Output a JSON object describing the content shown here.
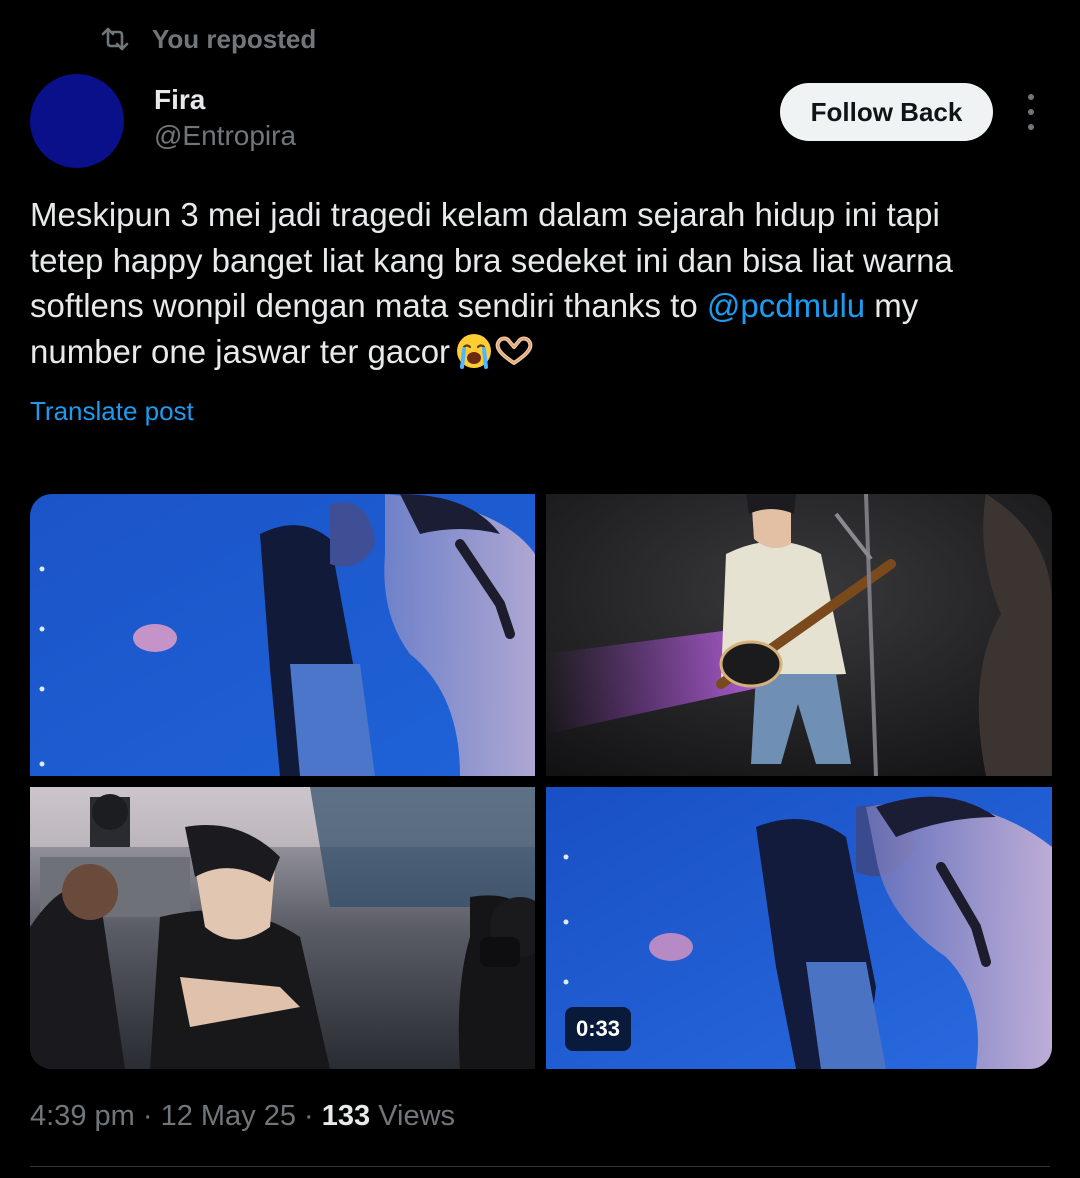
{
  "repost": {
    "label": "You reposted",
    "icon": "repost-icon"
  },
  "author": {
    "name": "Fira",
    "handle": "@Entropira",
    "avatar_color": "#0a0f8a"
  },
  "actions": {
    "follow_label": "Follow Back",
    "more_icon": "more-vertical-icon"
  },
  "tweet": {
    "line1": "Meskipun 3 mei jadi tragedi kelam dalam sejarah hidup ini tapi",
    "line2": "tetep happy banget liat kang bra sedeket ini dan bisa liat warna",
    "line3_before": "softlens wonpil dengan mata sendiri thanks to ",
    "mention": "@pcdmulu",
    "line3_after": " my",
    "line4": "number one jaswar ter gacor",
    "emojis": [
      "loudly-crying-face-emoji",
      "heart-hands-emoji"
    ]
  },
  "translate_label": "Translate post",
  "media": [
    {
      "type": "photo",
      "scene": "singer-blue-stage"
    },
    {
      "type": "photo",
      "scene": "bassist-on-stage"
    },
    {
      "type": "photo",
      "scene": "performer-reaching-out"
    },
    {
      "type": "video",
      "scene": "singer-blue-stage",
      "duration": "0:33"
    }
  ],
  "meta": {
    "time": "4:39 pm",
    "sep1": " · ",
    "date": "12 May 25",
    "sep2": " · ",
    "views_count": "133",
    "views_label": " Views"
  },
  "colors": {
    "accent": "#1d9bf0",
    "text": "#e7e9ea",
    "muted": "#71767b",
    "background": "#000000"
  }
}
